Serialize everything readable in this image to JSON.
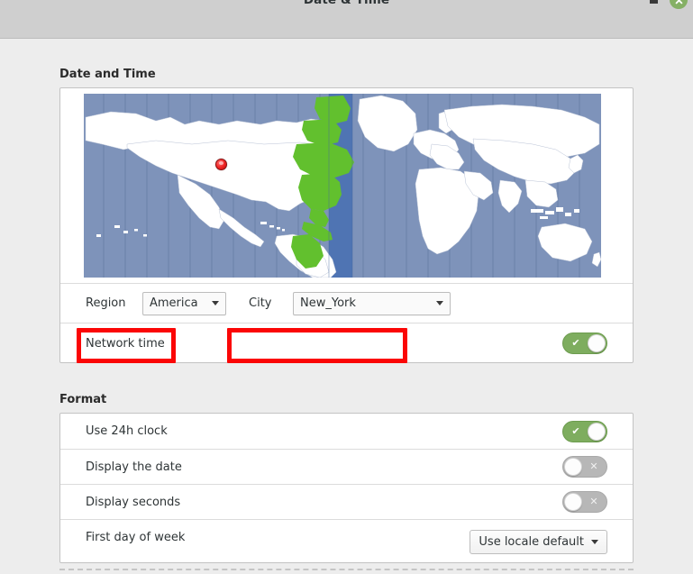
{
  "window": {
    "title": "Date & Time",
    "close_icon": "close-icon",
    "minimize_icon": "minimize-icon",
    "accent_green": "#85b065"
  },
  "sections": {
    "datetime": {
      "title": "Date and Time",
      "map": {
        "ocean_color": "#7e93ba",
        "land_color": "#ffffff",
        "highlight_color": "#62c02e",
        "band_color": "#4f74b3",
        "marker_color": "#ee2222",
        "marker_label": "location-marker"
      },
      "region": {
        "label": "Region",
        "value": "America",
        "highlighted": true,
        "highlight_color": "#fb0606"
      },
      "city": {
        "label": "City",
        "value": "New_York",
        "highlighted": true,
        "highlight_color": "#fb0606"
      },
      "network_time": {
        "label": "Network time",
        "state": "on",
        "symbol": "✔"
      }
    },
    "format": {
      "title": "Format",
      "rows": [
        {
          "label": "Use 24h clock",
          "type": "switch",
          "state": "on",
          "symbol": "✔"
        },
        {
          "label": "Display the date",
          "type": "switch",
          "state": "off",
          "symbol": "✕"
        },
        {
          "label": "Display seconds",
          "type": "switch",
          "state": "off",
          "symbol": "✕"
        },
        {
          "label": "First day of week",
          "type": "dropdown",
          "value": "Use locale default"
        }
      ]
    }
  },
  "colors": {
    "switch_on": "#7ead5f",
    "switch_off": "#b7b7b7",
    "panel_bg": "#ffffff",
    "body_bg": "#ededed",
    "header_bg": "#cfcfcf"
  }
}
